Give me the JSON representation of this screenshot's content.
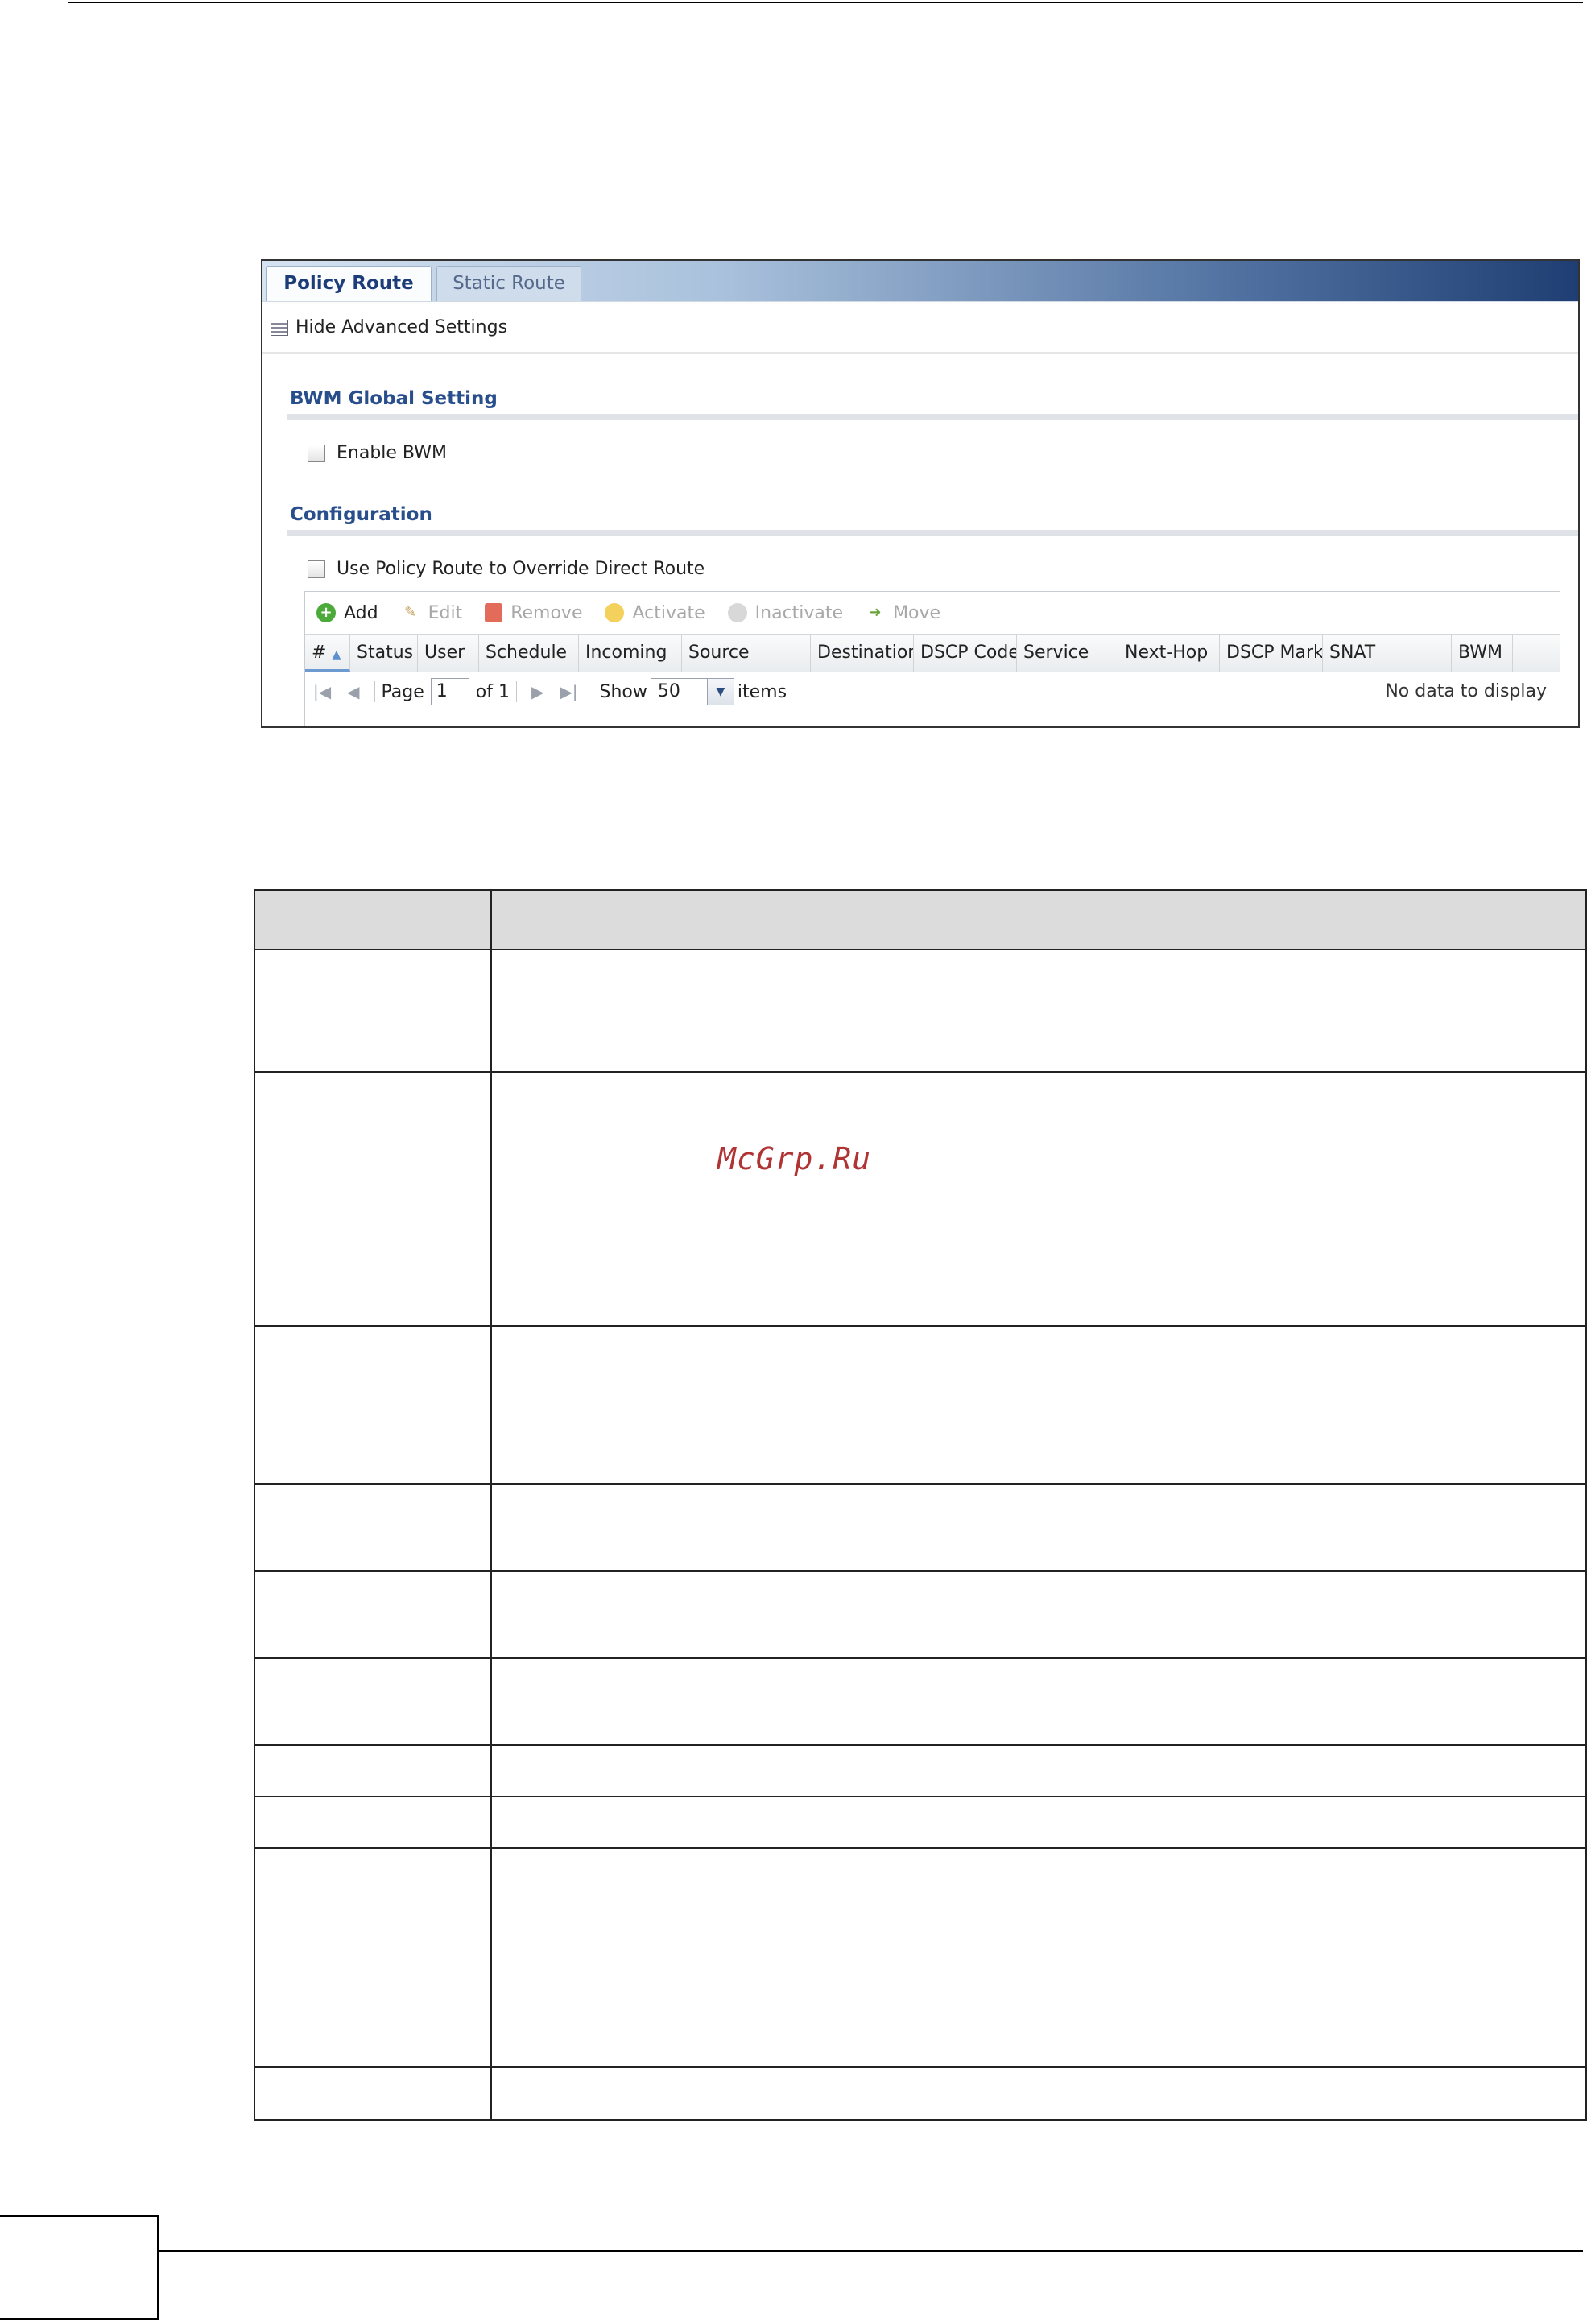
{
  "tabs": [
    {
      "label": "Policy Route",
      "active": true
    },
    {
      "label": "Static Route",
      "active": false
    }
  ],
  "advanced_link": "Hide Advanced Settings",
  "bwm_section": {
    "title": "BWM Global Setting",
    "enable_label": "Enable BWM",
    "enable_checked": false
  },
  "config_section": {
    "title": "Configuration",
    "override_label": "Use Policy Route to Override Direct Route",
    "override_checked": false
  },
  "toolbar": {
    "add": "Add",
    "edit": "Edit",
    "remove": "Remove",
    "activate": "Activate",
    "inactivate": "Inactivate",
    "move": "Move"
  },
  "columns": [
    "#",
    "Status",
    "User",
    "Schedule",
    "Incoming",
    "Source",
    "Destination",
    "DSCP Code",
    "Service",
    "Next-Hop",
    "DSCP Mark",
    "SNAT",
    "BWM"
  ],
  "pager": {
    "page_label": "Page",
    "page_value": "1",
    "of_label": "of 1",
    "show_label": "Show",
    "show_value": "50",
    "items_label": "items",
    "empty_text": "No data to display"
  },
  "watermark": "McGrp.Ru",
  "colors": {
    "tab_active_text": "#1c3d78",
    "section_title": "#294e8c",
    "watermark": "#b03434"
  }
}
